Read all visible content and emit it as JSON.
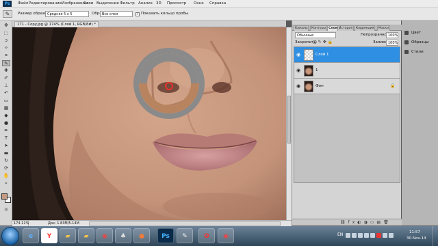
{
  "app": {
    "logo": "Ps",
    "menu": [
      "Файл",
      "Редактирование",
      "Изображение",
      "Слои",
      "Выделение",
      "Фильтр",
      "Анализ",
      "3D",
      "Просмотр",
      "Окно",
      "Справка"
    ]
  },
  "options": {
    "sample_size_label": "Размер образца:",
    "sample_size_value": "Средняя 5 x 5",
    "sample_label": "Образец:",
    "sample_value": "Все слои",
    "ring_label": "Показать кольцо пробы",
    "ring_checked": true
  },
  "document": {
    "tab_title": "171 - Copy.jpg @ 174% (Слой 1, RGB/8#) *",
    "zoom": "174.11%",
    "doc_info": "Док: 1.83M/5.14M"
  },
  "panel": {
    "tabs": [
      "Каналы",
      "Контуры",
      "Слои",
      "История",
      "Коррекция",
      "Маски"
    ],
    "active_tab": "Слои",
    "blend_mode": "Обычные",
    "opacity_label": "Непрозрачность:",
    "opacity_value": "100%",
    "lock_label": "Закрепить:",
    "fill_label": "Заливка:",
    "fill_value": "100%",
    "layers": [
      {
        "name": "Слой 1",
        "selected": true
      },
      {
        "name": "1",
        "selected": false
      },
      {
        "name": "Фон",
        "selected": false
      }
    ]
  },
  "side_panels": [
    "Цвет",
    "Образцы",
    "Стили"
  ],
  "taskbar": {
    "lang": "EN",
    "time": "11:57",
    "date": "30-Nov-14",
    "apps": [
      "IE",
      "Y",
      "Folder",
      "Folder",
      "Chrome",
      "Games",
      "App",
      "Photoshop",
      "Paint",
      "Opera",
      "Chrome"
    ]
  },
  "colors": {
    "accent": "#2f8fe3",
    "foreground_swatch": "#c69a82",
    "background_swatch": "#ffffff",
    "sampler_top": "#8a8a8a",
    "sampler_bottom": "#b8845f"
  }
}
